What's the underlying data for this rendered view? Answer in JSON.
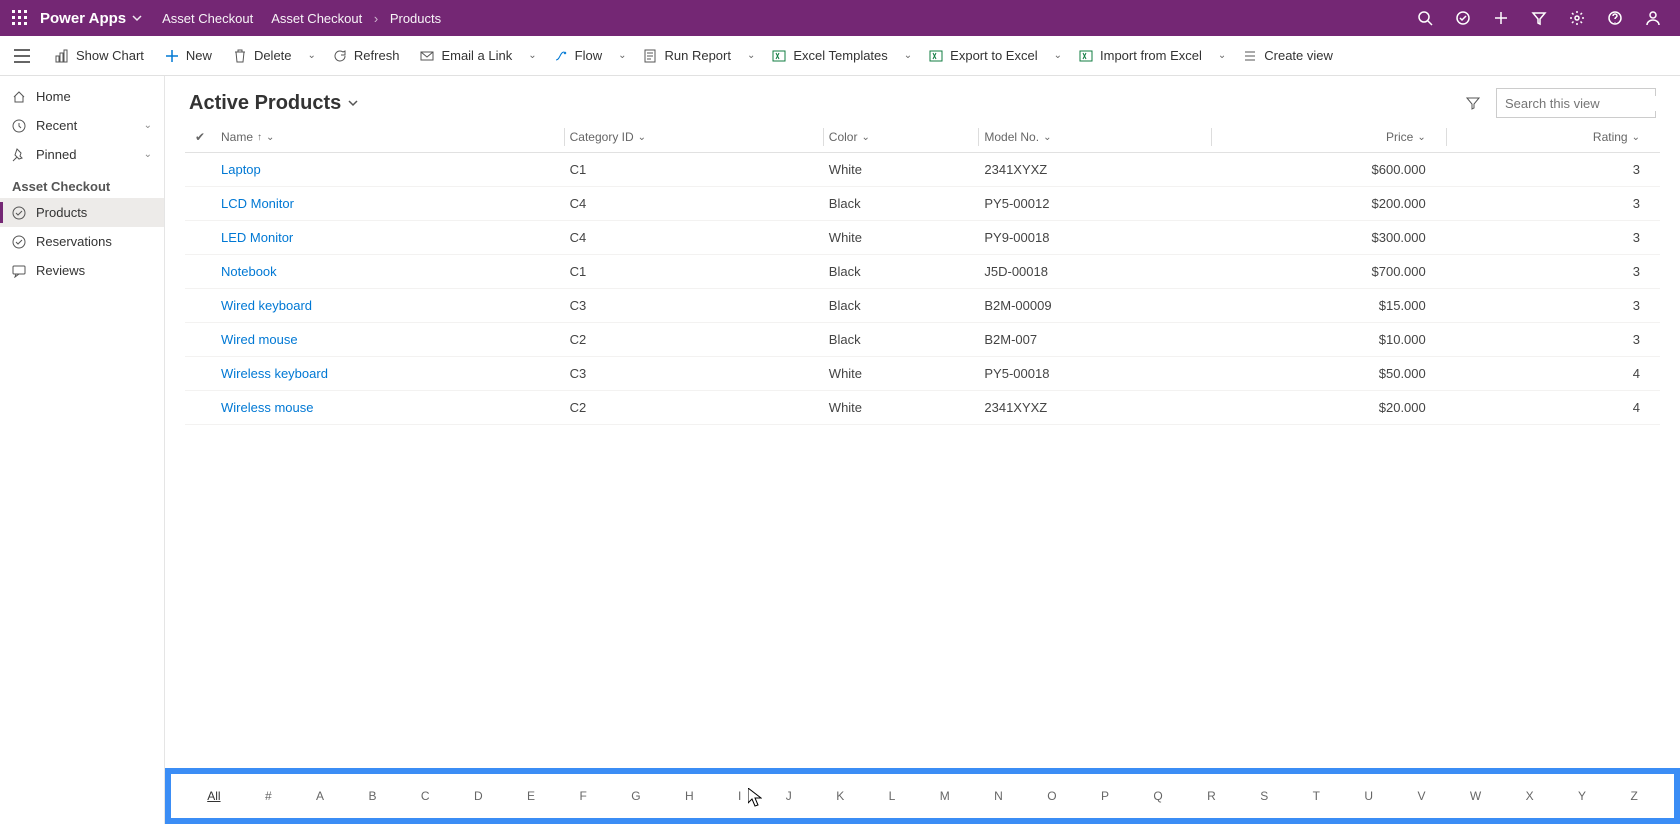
{
  "header": {
    "brand": "Power Apps",
    "crumb1": "Asset Checkout",
    "crumb2a": "Asset Checkout",
    "crumb2b": "Products"
  },
  "cmdbar": {
    "showChart": "Show Chart",
    "new": "New",
    "delete": "Delete",
    "refresh": "Refresh",
    "emailLink": "Email a Link",
    "flow": "Flow",
    "runReport": "Run Report",
    "excelTemplates": "Excel Templates",
    "exportExcel": "Export to Excel",
    "importExcel": "Import from Excel",
    "createView": "Create view"
  },
  "sidebar": {
    "home": "Home",
    "recent": "Recent",
    "pinned": "Pinned",
    "section": "Asset Checkout",
    "products": "Products",
    "reservations": "Reservations",
    "reviews": "Reviews"
  },
  "view": {
    "title": "Active Products",
    "searchPlaceholder": "Search this view"
  },
  "columns": {
    "name": "Name",
    "category": "Category ID",
    "color": "Color",
    "model": "Model No.",
    "price": "Price",
    "rating": "Rating"
  },
  "rows": [
    {
      "name": "Laptop",
      "category": "C1",
      "color": "White",
      "model": "2341XYXZ",
      "price": "$600.000",
      "rating": "3"
    },
    {
      "name": "LCD Monitor",
      "category": "C4",
      "color": "Black",
      "model": "PY5-00012",
      "price": "$200.000",
      "rating": "3"
    },
    {
      "name": "LED Monitor",
      "category": "C4",
      "color": "White",
      "model": "PY9-00018",
      "price": "$300.000",
      "rating": "3"
    },
    {
      "name": "Notebook",
      "category": "C1",
      "color": "Black",
      "model": "J5D-00018",
      "price": "$700.000",
      "rating": "3"
    },
    {
      "name": "Wired keyboard",
      "category": "C3",
      "color": "Black",
      "model": "B2M-00009",
      "price": "$15.000",
      "rating": "3"
    },
    {
      "name": "Wired mouse",
      "category": "C2",
      "color": "Black",
      "model": "B2M-007",
      "price": "$10.000",
      "rating": "3"
    },
    {
      "name": "Wireless keyboard",
      "category": "C3",
      "color": "White",
      "model": "PY5-00018",
      "price": "$50.000",
      "rating": "4"
    },
    {
      "name": "Wireless mouse",
      "category": "C2",
      "color": "White",
      "model": "2341XYXZ",
      "price": "$20.000",
      "rating": "4"
    }
  ],
  "alpha": [
    "All",
    "#",
    "A",
    "B",
    "C",
    "D",
    "E",
    "F",
    "G",
    "H",
    "I",
    "J",
    "K",
    "L",
    "M",
    "N",
    "O",
    "P",
    "Q",
    "R",
    "S",
    "T",
    "U",
    "V",
    "W",
    "X",
    "Y",
    "Z"
  ]
}
